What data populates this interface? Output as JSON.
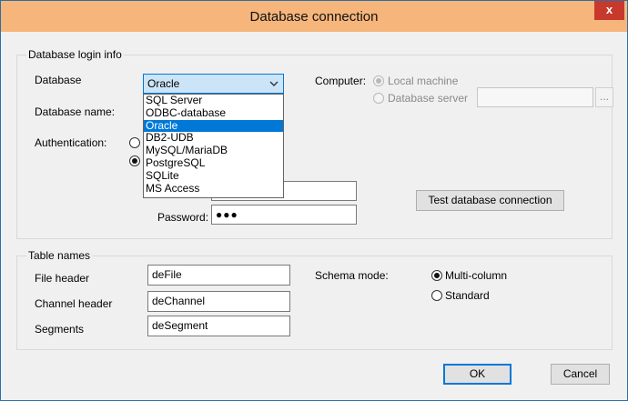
{
  "window": {
    "title": "Database connection",
    "close_glyph": "x"
  },
  "login_group": {
    "label": "Database login info",
    "database_label": "Database",
    "database_selected": "Oracle",
    "database_options": [
      "SQL Server",
      "ODBC-database",
      "Oracle",
      "DB2-UDB",
      "MySQL/MariaDB",
      "PostgreSQL",
      "SQLite",
      "MS Access"
    ],
    "database_selected_index": 2,
    "database_name_label": "Database name:",
    "authentication_label": "Authentication:",
    "auth_option_1_checked": false,
    "auth_option_2_checked": true,
    "user_value": "",
    "password_label": "Password:",
    "password_value": "●●●",
    "computer_label": "Computer:",
    "local_machine_label": "Local machine",
    "database_server_label": "Database server",
    "server_value": "",
    "browse_label": "...",
    "test_button_label": "Test database connection"
  },
  "table_group": {
    "label": "Table names",
    "file_header_label": "File header",
    "file_header_value": "deFile",
    "channel_header_label": "Channel header",
    "channel_header_value": "deChannel",
    "segments_label": "Segments",
    "segments_value": "deSegment",
    "schema_mode_label": "Schema mode:",
    "multi_column_label": "Multi-column",
    "standard_label": "Standard",
    "multi_column_checked": true
  },
  "footer": {
    "ok_label": "OK",
    "cancel_label": "Cancel"
  },
  "icons": {
    "close": "close-icon",
    "dropdown": "chevron-down-icon"
  },
  "colors": {
    "titlebar": "#f5b57b",
    "close_button": "#c8392d",
    "accent": "#0078d7",
    "window_border": "#2b6ea8"
  }
}
